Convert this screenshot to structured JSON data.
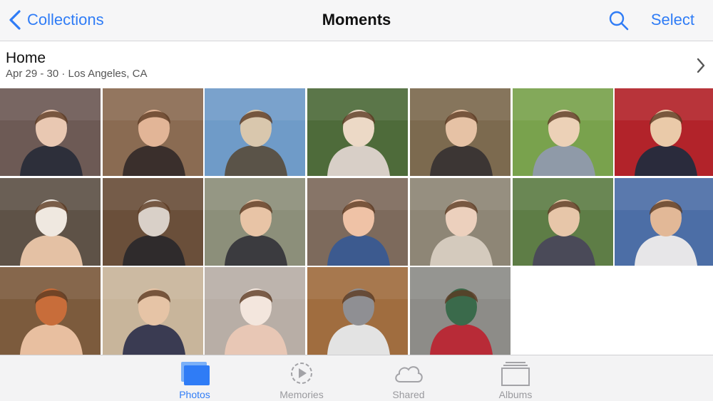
{
  "nav": {
    "back_label": "Collections",
    "title": "Moments",
    "search_icon": "search-icon",
    "select_label": "Select"
  },
  "moment": {
    "title": "Home",
    "subtitle": "Apr 29 - 30 · Los Angeles, CA"
  },
  "photos": [
    {
      "bg": "#6d5a55",
      "a": "#2d2f3a",
      "b": "#e9c8b2"
    },
    {
      "bg": "#8a6b52",
      "a": "#3a2f2c",
      "b": "#e2b597"
    },
    {
      "bg": "#6f9bc8",
      "a": "#5a5348",
      "b": "#d9c7ad"
    },
    {
      "bg": "#4e6b3a",
      "a": "#d8cfc7",
      "b": "#ecd9c6"
    },
    {
      "bg": "#7c6a4f",
      "a": "#3c3634",
      "b": "#e6c2a5"
    },
    {
      "bg": "#79a24d",
      "a": "#8f9aa8",
      "b": "#ecd1b7"
    },
    {
      "bg": "#b2232a",
      "a": "#2a2b3c",
      "b": "#eacaa9"
    },
    {
      "bg": "#5e5247",
      "a": "#e4c1a4",
      "b": "#efe8e0"
    },
    {
      "bg": "#6a4f3a",
      "a": "#2f2b2c",
      "b": "#d9d0c8"
    },
    {
      "bg": "#8c8f7a",
      "a": "#3b3b3f",
      "b": "#e8c4a6"
    },
    {
      "bg": "#7d6a5c",
      "a": "#3c5a8f",
      "b": "#efc2a6"
    },
    {
      "bg": "#8e8676",
      "a": "#d4cabd",
      "b": "#ecd0bd"
    },
    {
      "bg": "#5e7d46",
      "a": "#4a4a58",
      "b": "#e7c6a9"
    },
    {
      "bg": "#4c6ea6",
      "a": "#e7e6e8",
      "b": "#e2b897"
    },
    {
      "bg": "#7c5b3d",
      "a": "#e8bfa0",
      "b": "#c86d3a"
    },
    {
      "bg": "#c8b59b",
      "a": "#3a3b52",
      "b": "#e6c4a6"
    },
    {
      "bg": "#b8aea6",
      "a": "#e8c7b5",
      "b": "#f3e6dd"
    },
    {
      "bg": "#a06d3f",
      "a": "#e3e3e3",
      "b": "#8f8f93"
    },
    {
      "bg": "#8d8c88",
      "a": "#b82b37",
      "b": "#3a6a4b"
    }
  ],
  "tabs": [
    {
      "label": "Photos",
      "icon": "photos-icon",
      "active": true
    },
    {
      "label": "Memories",
      "icon": "memories-icon",
      "active": false
    },
    {
      "label": "Shared",
      "icon": "shared-cloud-icon",
      "active": false
    },
    {
      "label": "Albums",
      "icon": "albums-icon",
      "active": false
    }
  ],
  "colors": {
    "accent": "#2f7cf6",
    "inactive_tab": "#9a9a9e"
  }
}
